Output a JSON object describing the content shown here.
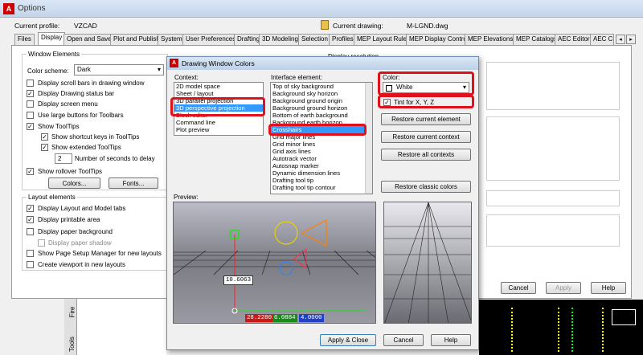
{
  "window": {
    "title": "Options",
    "profile_label": "Current profile:",
    "profile_value": "VZCAD",
    "drawing_label": "Current drawing:",
    "drawing_value": "M-LGND.dwg"
  },
  "tabs": [
    "Files",
    "Display",
    "Open and Save",
    "Plot and Publish",
    "System",
    "User Preferences",
    "Drafting",
    "3D Modeling",
    "Selection",
    "Profiles",
    "MEP Layout Rules",
    "MEP Display Control",
    "MEP Elevations",
    "MEP Catalogs",
    "AEC Editor",
    "AEC Co"
  ],
  "window_elements": {
    "group_label": "Window Elements",
    "color_scheme_label": "Color scheme:",
    "color_scheme_value": "Dark",
    "options": [
      {
        "label": "Display scroll bars in drawing window",
        "checked": false
      },
      {
        "label": "Display Drawing status bar",
        "checked": true
      },
      {
        "label": "Display screen menu",
        "checked": false
      },
      {
        "label": "Use large buttons for Toolbars",
        "checked": false
      },
      {
        "label": "Show ToolTips",
        "checked": true
      }
    ],
    "sub_options": [
      {
        "label": "Show shortcut keys in ToolTips",
        "checked": true
      },
      {
        "label": "Show extended ToolTips",
        "checked": true
      }
    ],
    "delay_value": "2",
    "delay_label": "Number of seconds to delay",
    "rollover_label": "Show rollover ToolTips",
    "colors_button": "Colors...",
    "fonts_button": "Fonts..."
  },
  "layout_elements": {
    "group_label": "Layout elements",
    "options": [
      {
        "label": "Display Layout and Model tabs",
        "checked": true
      },
      {
        "label": "Display printable area",
        "checked": true
      },
      {
        "label": "Display paper background",
        "checked": false
      },
      {
        "label": "Display paper shadow",
        "checked": false
      },
      {
        "label": "Show Page Setup Manager for new layouts",
        "checked": false
      },
      {
        "label": "Create viewport in new layouts",
        "checked": false
      }
    ]
  },
  "display_resolution_label": "Display resolution",
  "bottom_buttons": {
    "cancel": "Cancel",
    "apply": "Apply",
    "help": "Help"
  },
  "side_tabs": [
    "Fire",
    "Tools"
  ],
  "dialog": {
    "title": "Drawing Window Colors",
    "context_label": "Context:",
    "contexts": [
      "2D model space",
      "Sheet / layout",
      "3D parallel projection",
      "3D perspective projection",
      "Block editor",
      "Command line",
      "Plot preview"
    ],
    "selected_context": "3D perspective projection",
    "interface_label": "Interface element:",
    "elements": [
      "Top of sky background",
      "Background sky horizon",
      "Background ground origin",
      "Background ground horizon",
      "Bottom of earth background",
      "Background earth horizon",
      "Crosshairs",
      "Grid major lines",
      "Grid minor lines",
      "Grid axis lines",
      "Autotrack vector",
      "Autosnap marker",
      "Dynamic dimension lines",
      "Drafting tool tip",
      "Drafting tool tip contour"
    ],
    "selected_element": "Crosshairs",
    "color_label": "Color:",
    "color_value": "White",
    "color_hex": "#ffffff",
    "tint_label": "Tint for X, Y, Z",
    "tint_checked": true,
    "buttons": [
      "Restore current element",
      "Restore current context",
      "Restore all contexts",
      "Restore classic colors"
    ],
    "preview_label": "Preview:",
    "preview_values": {
      "a": "10.6063",
      "x": "28.2280",
      "y": "6.0884",
      "z": "4.0000"
    },
    "footer": {
      "apply_close": "Apply & Close",
      "cancel": "Cancel",
      "help": "Help"
    }
  },
  "colors": {
    "highlight": "#3399ff",
    "annotation": "#e0101c"
  }
}
